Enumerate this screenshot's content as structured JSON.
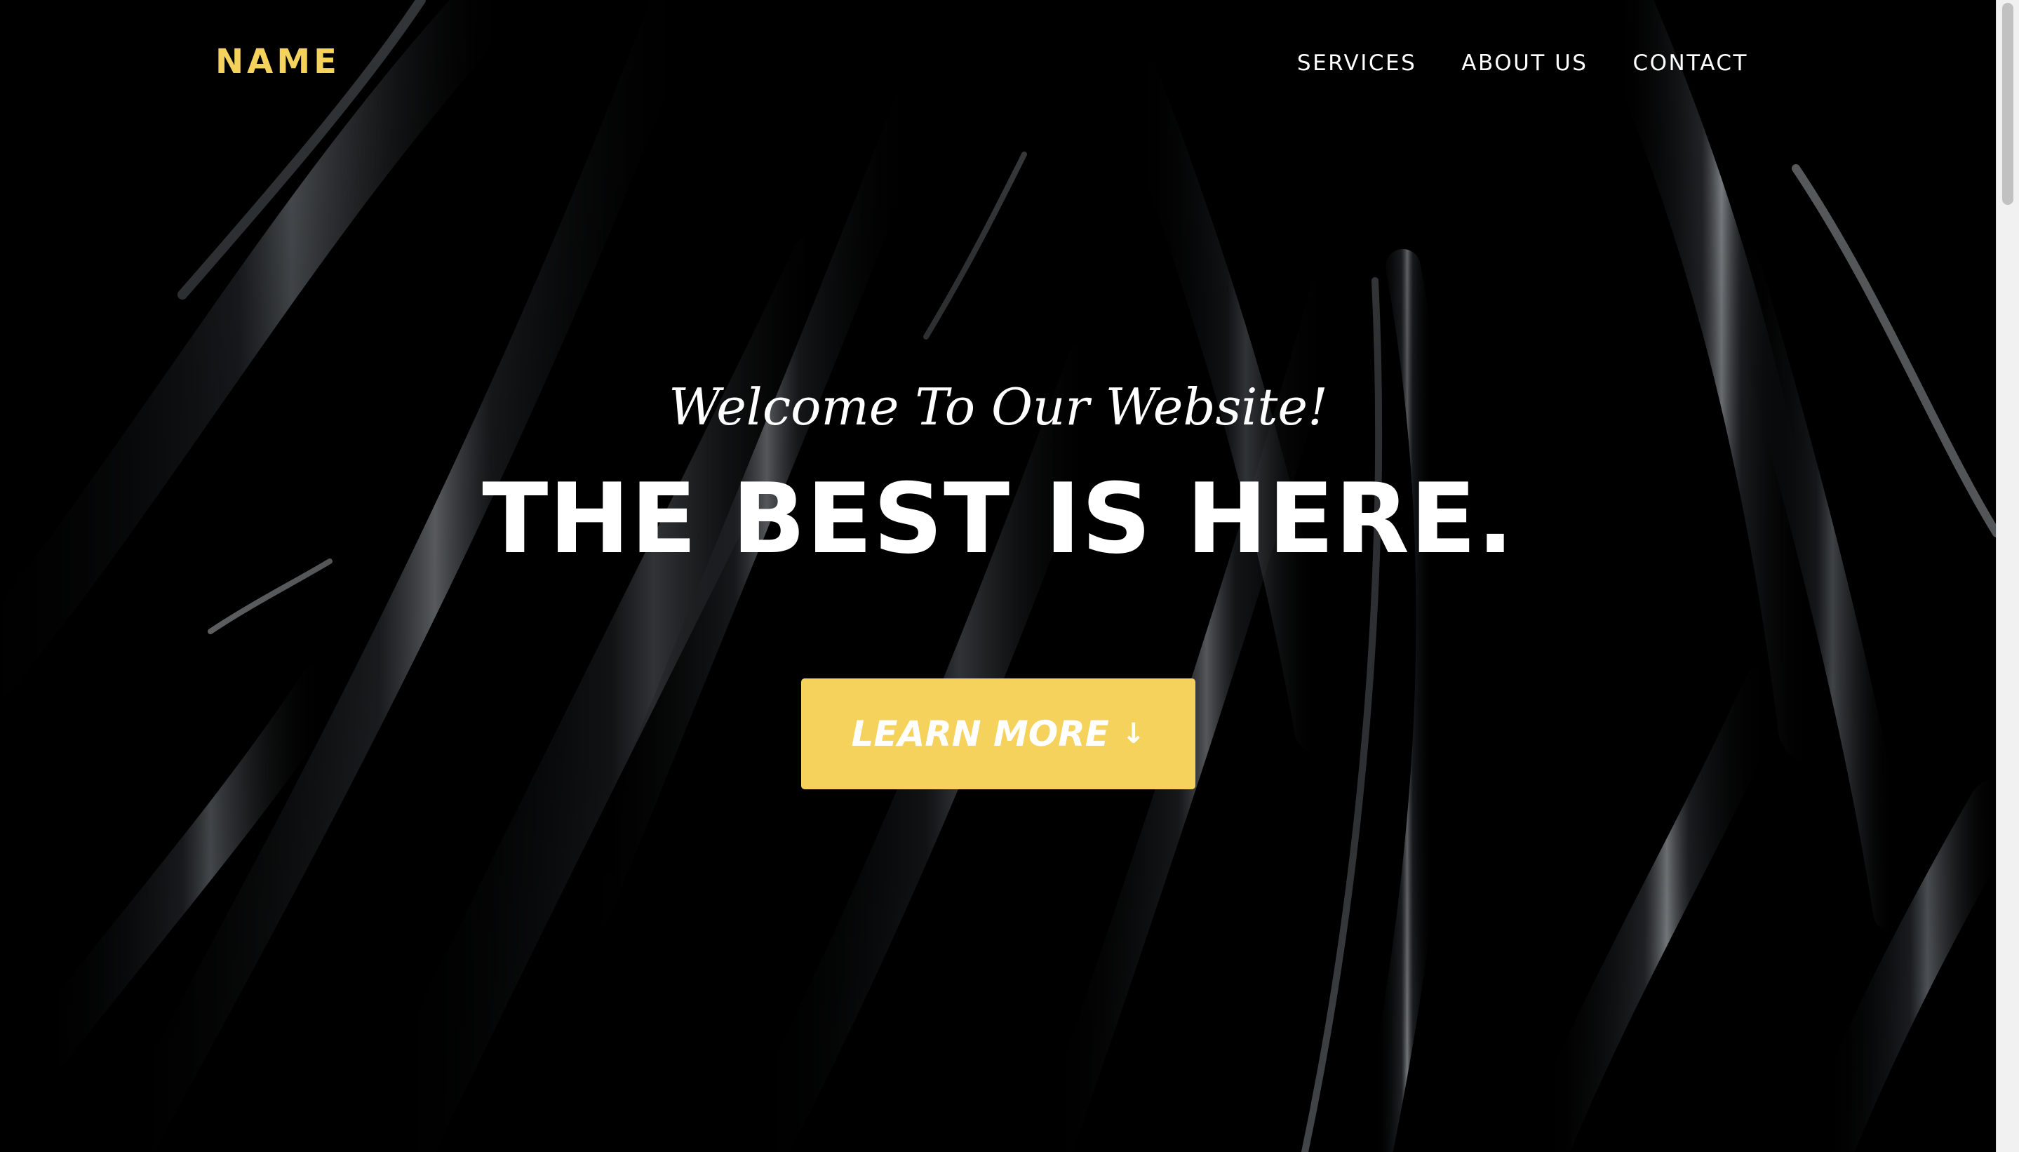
{
  "brand": {
    "name": "NAME",
    "accent_color": "#f5d25c"
  },
  "nav": {
    "links": [
      {
        "label": "SERVICES"
      },
      {
        "label": "ABOUT US"
      },
      {
        "label": "CONTACT"
      }
    ]
  },
  "hero": {
    "tagline": "Welcome To Our Website!",
    "headline": "THE BEST IS HERE.",
    "cta_label": "LEARN MORE",
    "cta_icon": "arrow-down-icon",
    "background": "abstract dark silk ribbons"
  },
  "colors": {
    "background": "#000000",
    "text": "#ffffff",
    "button": "#f5d25c"
  }
}
